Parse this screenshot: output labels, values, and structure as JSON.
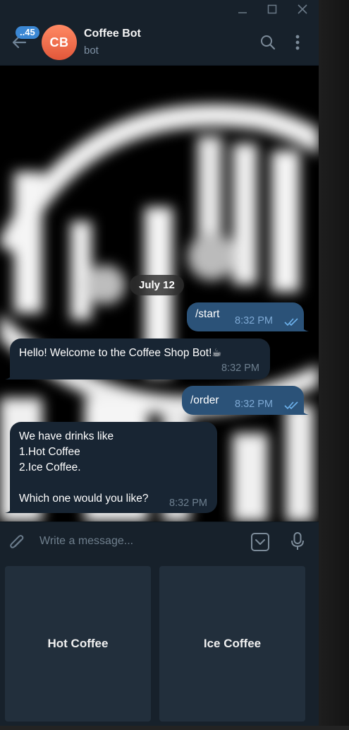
{
  "window": {
    "controls": [
      "minimize-icon",
      "maximize-icon",
      "close-icon"
    ]
  },
  "header": {
    "unread_badge": "..45",
    "avatar_initials": "CB",
    "avatar_color": "#f2704e",
    "chat_name": "Coffee Bot",
    "chat_status": "bot",
    "icons": [
      "back-arrow-icon",
      "search-icon",
      "more-vertical-icon"
    ]
  },
  "chat": {
    "date_separator": "July 12",
    "messages": [
      {
        "direction": "out",
        "text": "/start",
        "time": "8:32 PM",
        "status": "read"
      },
      {
        "direction": "in",
        "text": "Hello! Welcome to the Coffee Shop Bot!☕",
        "time": "8:32 PM"
      },
      {
        "direction": "out",
        "text": "/order",
        "time": "8:32 PM",
        "status": "read"
      },
      {
        "direction": "in",
        "text": "We have drinks like\n1.Hot Coffee\n2.Ice Coffee.\n\nWhich one would you like?",
        "time": "8:32 PM"
      }
    ]
  },
  "composer": {
    "placeholder": "Write a message...",
    "icons": [
      "attach-icon",
      "keyboard-toggle-icon",
      "microphone-icon"
    ]
  },
  "keyboard": {
    "buttons": [
      "Hot Coffee",
      "Ice Coffee"
    ]
  },
  "colors": {
    "app_bg": "#17212b",
    "outgoing_bubble": "#2b5278",
    "incoming_bubble": "#182533",
    "accent": "#3b87d3",
    "keyboard_button": "#222f3c"
  }
}
